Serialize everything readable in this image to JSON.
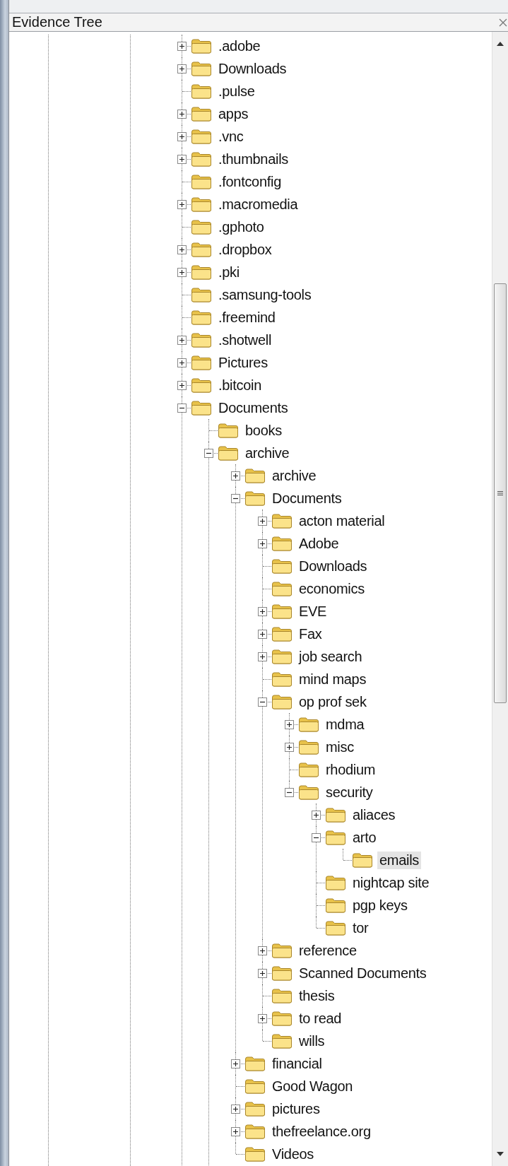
{
  "panel": {
    "title": "Evidence Tree"
  },
  "tree": [
    {
      "label": ".adobe",
      "expanded": false,
      "selected": false
    },
    {
      "label": "Downloads",
      "expanded": false,
      "selected": false
    },
    {
      "label": ".pulse",
      "selected": false
    },
    {
      "label": "apps",
      "expanded": false,
      "selected": false
    },
    {
      "label": ".vnc",
      "expanded": false,
      "selected": false
    },
    {
      "label": ".thumbnails",
      "expanded": false,
      "selected": false
    },
    {
      "label": ".fontconfig",
      "selected": false
    },
    {
      "label": ".macromedia",
      "expanded": false,
      "selected": false
    },
    {
      "label": ".gphoto",
      "selected": false
    },
    {
      "label": ".dropbox",
      "expanded": false,
      "selected": false
    },
    {
      "label": ".pki",
      "expanded": false,
      "selected": false
    },
    {
      "label": ".samsung-tools",
      "selected": false
    },
    {
      "label": ".freemind",
      "selected": false
    },
    {
      "label": ".shotwell",
      "expanded": false,
      "selected": false
    },
    {
      "label": "Pictures",
      "expanded": false,
      "selected": false
    },
    {
      "label": ".bitcoin",
      "expanded": false,
      "selected": false
    },
    {
      "label": "Documents",
      "expanded": true,
      "selected": false,
      "children": [
        {
          "label": "books",
          "selected": false
        },
        {
          "label": "archive",
          "expanded": true,
          "selected": false,
          "children": [
            {
              "label": "archive",
              "expanded": false,
              "selected": false
            },
            {
              "label": "Documents",
              "expanded": true,
              "selected": false,
              "children": [
                {
                  "label": "acton material",
                  "expanded": false,
                  "selected": false
                },
                {
                  "label": "Adobe",
                  "expanded": false,
                  "selected": false
                },
                {
                  "label": "Downloads",
                  "selected": false
                },
                {
                  "label": "economics",
                  "selected": false
                },
                {
                  "label": "EVE",
                  "expanded": false,
                  "selected": false
                },
                {
                  "label": "Fax",
                  "expanded": false,
                  "selected": false
                },
                {
                  "label": "job search",
                  "expanded": false,
                  "selected": false
                },
                {
                  "label": "mind maps",
                  "selected": false
                },
                {
                  "label": "op prof sek",
                  "expanded": true,
                  "selected": false,
                  "children": [
                    {
                      "label": "mdma",
                      "expanded": false,
                      "selected": false
                    },
                    {
                      "label": "misc",
                      "expanded": false,
                      "selected": false
                    },
                    {
                      "label": "rhodium",
                      "selected": false
                    },
                    {
                      "label": "security",
                      "expanded": true,
                      "selected": false,
                      "children": [
                        {
                          "label": "aliaces",
                          "expanded": false,
                          "selected": false
                        },
                        {
                          "label": "arto",
                          "expanded": true,
                          "selected": false,
                          "children": [
                            {
                              "label": "emails",
                              "selected": true
                            }
                          ]
                        },
                        {
                          "label": "nightcap site",
                          "selected": false
                        },
                        {
                          "label": "pgp keys",
                          "selected": false
                        },
                        {
                          "label": "tor",
                          "selected": false
                        }
                      ]
                    }
                  ]
                },
                {
                  "label": "reference",
                  "expanded": false,
                  "selected": false
                },
                {
                  "label": "Scanned Documents",
                  "expanded": false,
                  "selected": false
                },
                {
                  "label": "thesis",
                  "selected": false
                },
                {
                  "label": "to read",
                  "expanded": false,
                  "selected": false
                },
                {
                  "label": "wills",
                  "selected": false
                }
              ]
            },
            {
              "label": "financial",
              "expanded": false,
              "selected": false
            },
            {
              "label": "Good Wagon",
              "selected": false
            },
            {
              "label": "pictures",
              "expanded": false,
              "selected": false
            },
            {
              "label": "thefreelance.org",
              "expanded": false,
              "selected": false
            },
            {
              "label": "Videos",
              "selected": false
            }
          ]
        }
      ]
    }
  ]
}
